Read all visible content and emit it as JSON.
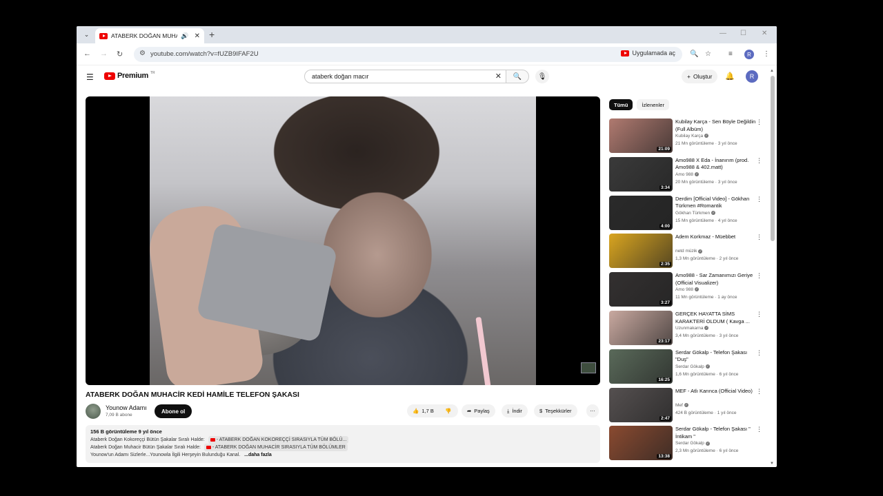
{
  "browser": {
    "tab_title": "ATABERK DOĞAN MUHACİR",
    "url": "youtube.com/watch?v=fUZB9IFAF2U",
    "open_in_app": "Uygulamada aç",
    "profile_initial": "R"
  },
  "header": {
    "logo_text": "Premium",
    "logo_region": "TR",
    "search_query": "ataberk doğan macır",
    "create_label": "Oluştur",
    "avatar_initial": "R"
  },
  "video": {
    "title": "ATABERK DOĞAN MUHACİR KEDİ HAMİLE TELEFON ŞAKASI",
    "channel": "Younow Adamı",
    "subscribers": "7,09 B abone",
    "subscribe_label": "Abone ol",
    "likes": "1,7 B",
    "share_label": "Paylaş",
    "download_label": "İndir",
    "thanks_label": "Teşekkürler"
  },
  "description": {
    "meta": "156 B görüntüleme  9 yıl önce",
    "line1_text": "Ataberk Doğan Kokoreççi Bütün Şakalar Sıralı Halde:",
    "line1_chip": "- ATABERK DOĞAN KOKOREÇÇİ SIRASIYLA TÜM BÖLÜ...",
    "line2_text": "Ataberk Doğan Muhacir Bütün Şakalar Sıralı Halde:",
    "line2_chip": "- ATABERK DOĞAN MUHACİR SIRASIYLA TÜM BÖLÜMLER",
    "line3_text": "Younow'un Adamı Sizlerle...Younowla İlgili Herşeyin Bulunduğu Kanal.",
    "more_label": "...daha fazla"
  },
  "sidebar": {
    "chips": [
      "Tümü",
      "İzlenenler"
    ],
    "items": [
      {
        "title": "Kubilay Karça - Sen Böyle Değildin (Full Albüm)",
        "channel": "Kubilay Karça",
        "stats": "21 Mn görüntüleme · 3 yıl önce",
        "duration": "21:09",
        "color": "#b07a70"
      },
      {
        "title": "Amo988 X Eda - İnanırım (prod. Amo988 & 402.matt)",
        "channel": "Amo 988",
        "stats": "20 Mn görüntüleme · 3 yıl önce",
        "duration": "3:34",
        "color": "#3a3a3a"
      },
      {
        "title": "Derdim [Official Video] - Gökhan Türkmen #Romantik",
        "channel": "Gökhan Türkmen",
        "stats": "15 Mn görüntüleme · 4 yıl önce",
        "duration": "4:00",
        "color": "#2a2a2a"
      },
      {
        "title": "Adem Korkmaz - Müebbet",
        "channel": "netd müzik",
        "stats": "1,3 Mn görüntüleme · 2 yıl önce",
        "duration": "2:35",
        "color": "#d9a520"
      },
      {
        "title": "Amo988 - Sar Zamanımızı Geriye (Official Visualizer)",
        "channel": "Amo 988",
        "stats": "11 Mn görüntüleme · 1 ay önce",
        "duration": "3:27",
        "color": "#333030"
      },
      {
        "title": "GERÇEK HAYATTA SİMS KARAKTERİ OLDUM ( Kavga ...",
        "channel": "Uzunmakarna",
        "stats": "3,4 Mn görüntüleme · 3 yıl önce",
        "duration": "23:17",
        "color": "#c9a9a0"
      },
      {
        "title": "Serdar Gökalp - Telefon Şakası \"Duş\"",
        "channel": "Serdar Gökalp",
        "stats": "1,6 Mn görüntüleme · 6 yıl önce",
        "duration": "16:25",
        "color": "#5a6a5a"
      },
      {
        "title": "MEF - Atlı Karınca (Official Video)",
        "channel": "Mef",
        "stats": "424 B görüntüleme · 1 yıl önce",
        "duration": "2:47",
        "color": "#555050"
      },
      {
        "title": "Serdar Gökalp - Telefon Şakası \" İntikam \"",
        "channel": "Serdar Gökalp",
        "stats": "2,3 Mn görüntüleme · 6 yıl önce",
        "duration": "13:38",
        "color": "#8a4a30"
      }
    ]
  }
}
